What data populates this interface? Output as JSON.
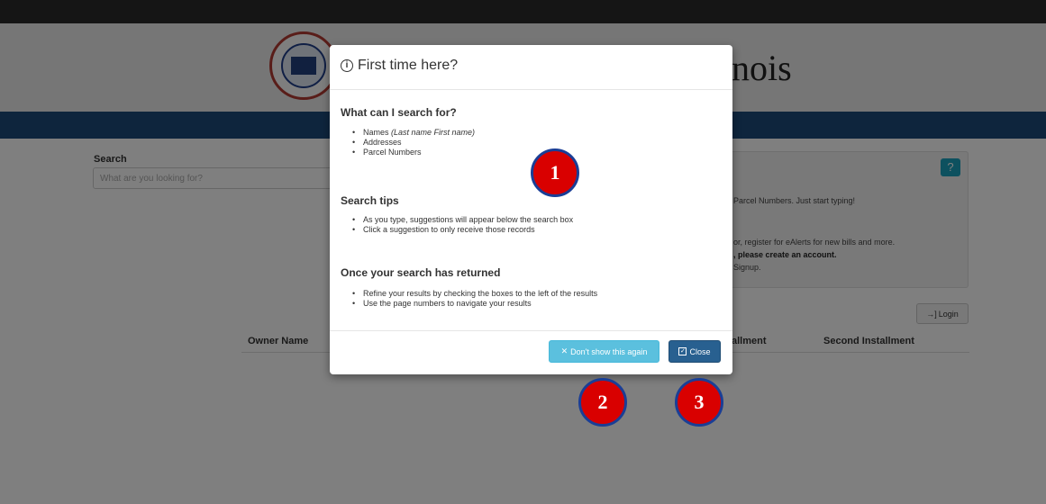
{
  "header": {
    "title_fragment": "nois"
  },
  "search": {
    "label": "Search",
    "placeholder": "What are you looking for?"
  },
  "info_panel": {
    "help_icon": "question-circle-icon",
    "line1": "Parcel Numbers. Just start typing!",
    "line2": "or, register for eAlerts for new bills and more.",
    "line3": ", please create an account.",
    "line4": "Signup."
  },
  "login": {
    "label": "Login",
    "icon": "sign-in-icon"
  },
  "table": {
    "columns": [
      "Owner Name",
      "allment",
      "Second Installment"
    ]
  },
  "modal": {
    "title": "First time here?",
    "title_icon": "info-circle-icon",
    "sections": [
      {
        "heading": "What can I search for?",
        "items": [
          "Names",
          "(Last name First name)",
          "Addresses",
          "Parcel Numbers"
        ]
      },
      {
        "heading": "Search tips",
        "items": [
          "As you type, suggestions will appear below the search box",
          "Click a suggestion to only receive those records"
        ]
      },
      {
        "heading": "Once your search has returned",
        "items": [
          "Refine your results by checking the boxes to the left of the results",
          "Use the page numbers to navigate your results"
        ]
      }
    ],
    "dont_show_label": "Don't show this again",
    "close_label": "Close"
  },
  "callouts": [
    "1",
    "2",
    "3"
  ],
  "colors": {
    "topbar": "#2b2b2b",
    "bluebar": "#1d4a7a",
    "info_button": "#5bc0de",
    "primary_button": "#286090",
    "callout_fill": "#d90000",
    "callout_border": "#1a3e96"
  }
}
